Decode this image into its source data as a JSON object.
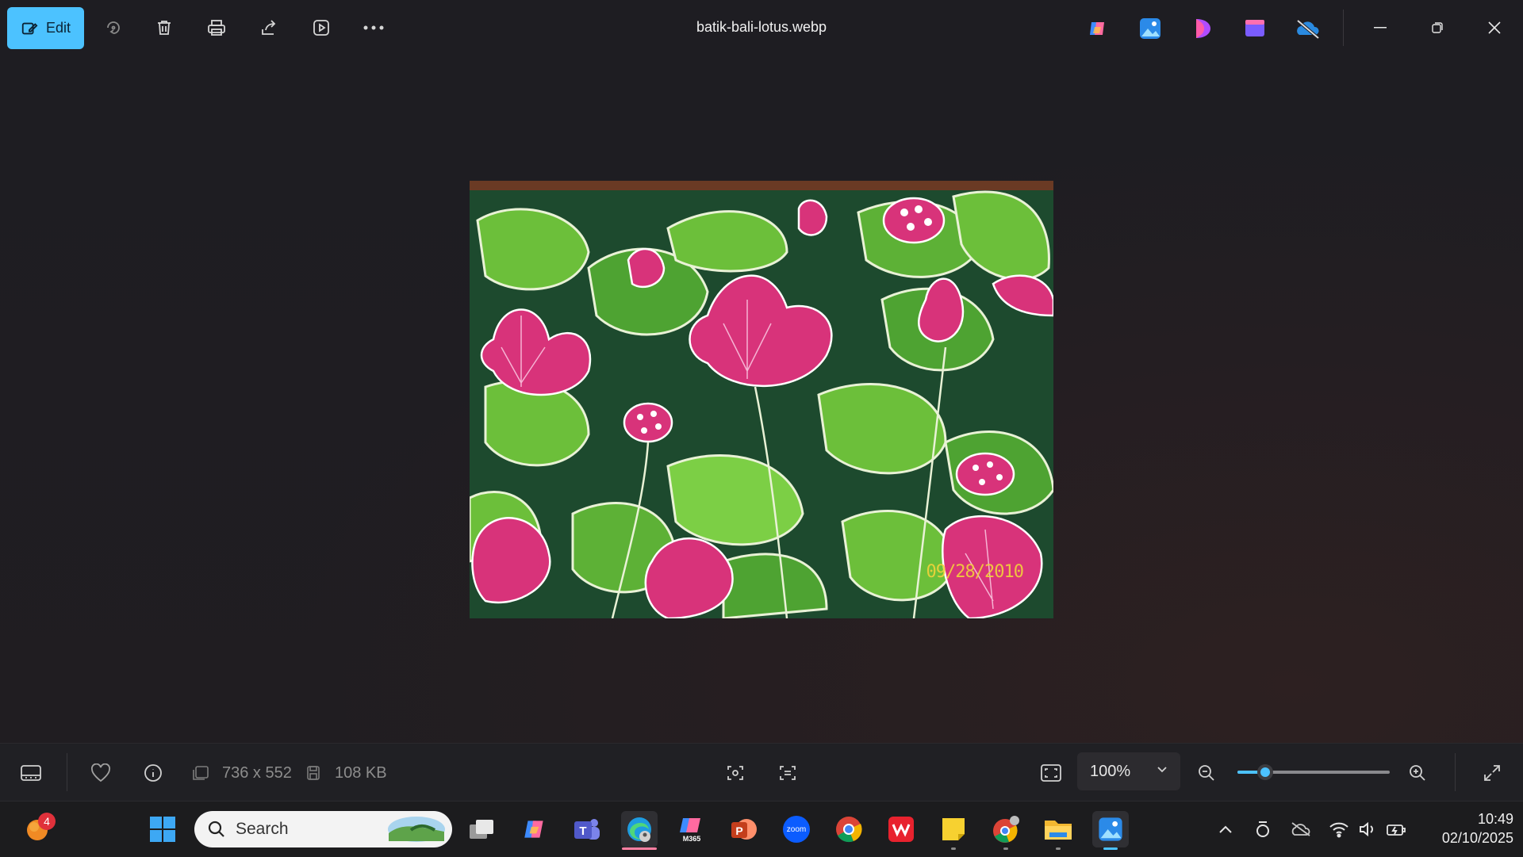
{
  "window": {
    "title": "batik-bali-lotus.webp",
    "edit_label": "Edit"
  },
  "toolbar_icons": [
    "edit-icon",
    "rotate-icon",
    "delete-icon",
    "print-icon",
    "share-icon",
    "slideshow-icon",
    "more-icon"
  ],
  "photo": {
    "date_stamp": "09/28/2010",
    "colors": {
      "dark_green": "#1d4a2e",
      "leaf_green": "#6cbf3a",
      "pink": "#d8337a"
    }
  },
  "status": {
    "dimensions": "736 x 552",
    "file_size": "108 KB",
    "zoom": "100%",
    "zoom_level_fraction": 0.18
  },
  "taskbar": {
    "search_placeholder": "Search",
    "notification_count": "4",
    "time": "10:49",
    "date": "02/10/2025"
  },
  "colors": {
    "accent": "#4cc2ff",
    "background": "#1f1d21"
  }
}
